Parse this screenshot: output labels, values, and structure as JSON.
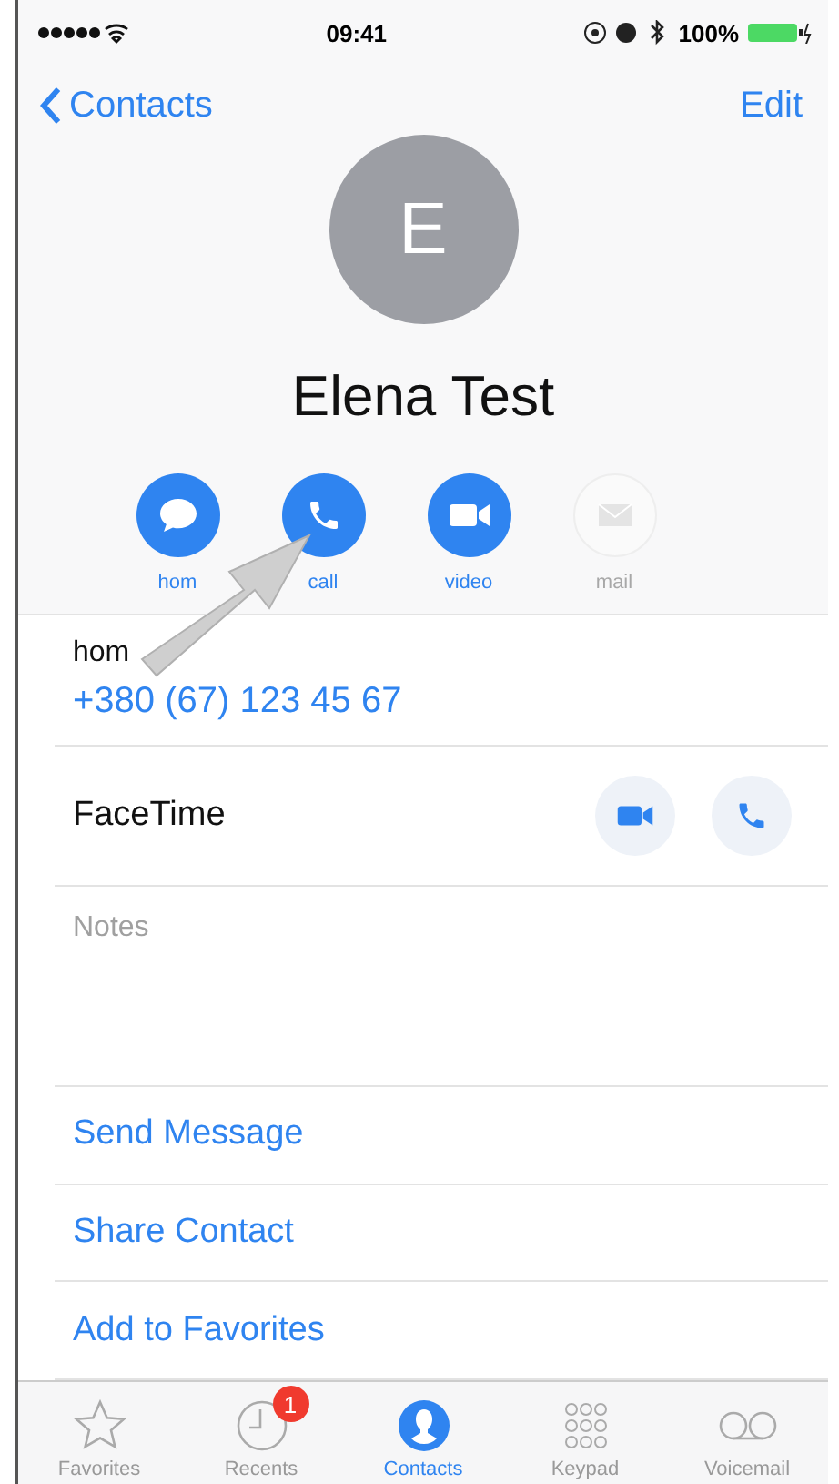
{
  "status_bar": {
    "time": "09:41",
    "battery": "100%"
  },
  "nav": {
    "back": "Contacts",
    "edit": "Edit"
  },
  "contact": {
    "initial": "E",
    "name": "Elena Test"
  },
  "actions": [
    {
      "kind": "message",
      "label": "hom",
      "disabled": false
    },
    {
      "kind": "phone",
      "label": "call",
      "disabled": false
    },
    {
      "kind": "video",
      "label": "video",
      "disabled": false
    },
    {
      "kind": "mail",
      "label": "mail",
      "disabled": true
    }
  ],
  "phone": {
    "label": "hom",
    "number": "+380 (67) 123 45 67"
  },
  "facetime": {
    "label": "FaceTime"
  },
  "notes": {
    "placeholder": "Notes"
  },
  "links": [
    "Send Message",
    "Share Contact",
    "Add to Favorites"
  ],
  "tabs": [
    {
      "kind": "star",
      "label": "Favorites",
      "selected": false
    },
    {
      "kind": "clock",
      "label": "Recents",
      "selected": false,
      "badge": "1"
    },
    {
      "kind": "person",
      "label": "Contacts",
      "selected": true
    },
    {
      "kind": "keypad",
      "label": "Keypad",
      "selected": false
    },
    {
      "kind": "voicemail",
      "label": "Voicemail",
      "selected": false
    }
  ]
}
